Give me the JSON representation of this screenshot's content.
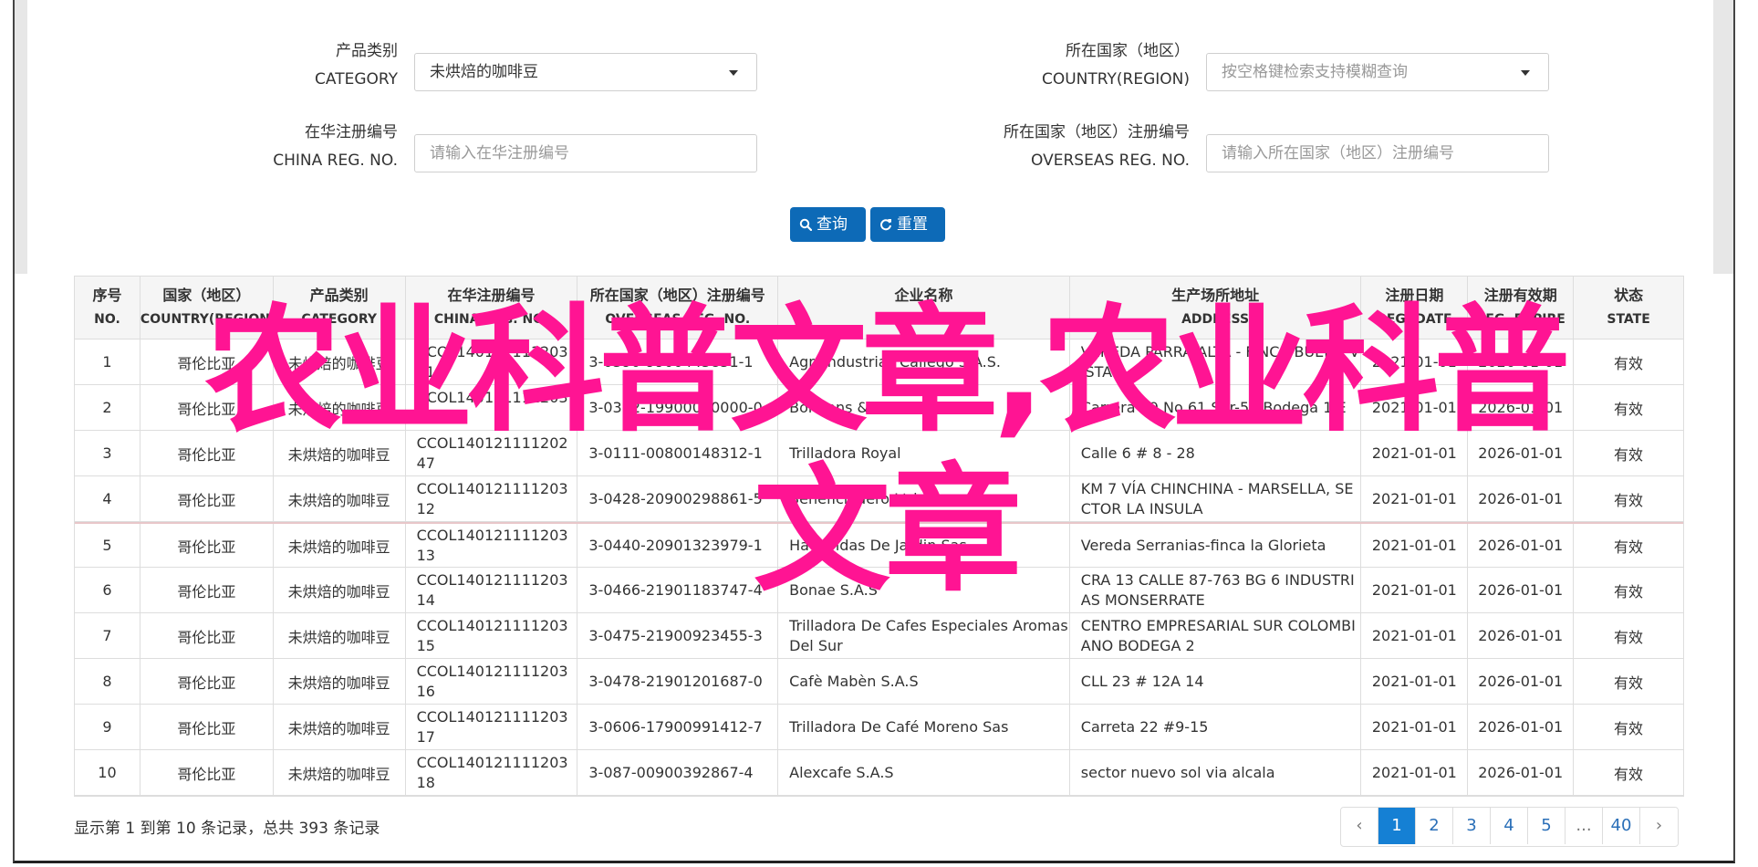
{
  "form": {
    "category_label_cn": "产品类别",
    "category_label_en": "CATEGORY",
    "category_value": "未烘焙的咖啡豆",
    "country_label_cn": "所在国家（地区）",
    "country_label_en": "COUNTRY(REGION)",
    "country_placeholder": "按空格键检索支持模糊查询",
    "china_reg_label_cn": "在华注册编号",
    "china_reg_label_en": "CHINA REG. NO.",
    "china_reg_placeholder": "请输入在华注册编号",
    "overseas_reg_label_cn": "所在国家（地区）注册编号",
    "overseas_reg_label_en": "OVERSEAS REG. NO.",
    "overseas_reg_placeholder": "请输入所在国家（地区）注册编号",
    "search_label": "查询",
    "reset_label": "重置",
    "button_color": "#0d6ab7"
  },
  "table": {
    "headers": [
      {
        "cn": "序号",
        "en": "NO."
      },
      {
        "cn": "国家（地区）",
        "en": "COUNTRY(REGION)"
      },
      {
        "cn": "产品类别",
        "en": "CATEGORY"
      },
      {
        "cn": "在华注册编号",
        "en": "CHINA REG. NO."
      },
      {
        "cn": "所在国家（地区）注册编号",
        "en": "OVERSEAS REG. NO."
      },
      {
        "cn": "企业名称",
        "en": "NAME"
      },
      {
        "cn": "生产场所地址",
        "en": "ADDRESS"
      },
      {
        "cn": "注册日期",
        "en": "REG. DATE"
      },
      {
        "cn": "注册有效期",
        "en": "REG. EXPIRE"
      },
      {
        "cn": "状态",
        "en": "STATE"
      }
    ],
    "rows": [
      {
        "no": "1",
        "country": "哥伦比亚",
        "category": "未烘焙的咖啡豆",
        "china_reg": "CCOL14012111120311",
        "overseas_reg": "3-0390-9900445851-1",
        "name": "Agroindustrias Callego S.A.S.",
        "address": "VEREDA PARRA ALTA - FINCA BUENA VISTA",
        "reg_date": "2021-01-01",
        "expire": "2026-01-01",
        "state": "有效"
      },
      {
        "no": "2",
        "country": "哥伦比亚",
        "category": "未烘焙的咖啡豆",
        "china_reg": "CCOL14012111120311",
        "overseas_reg": "3-0392-19900000000-0",
        "name": "Bonbons & Francis S.A.S.",
        "address": "Carrera 49 No 61 Sur-50 Bodega 1 E",
        "reg_date": "2021-01-01",
        "expire": "2026-01-01",
        "state": "有效"
      },
      {
        "no": "3",
        "country": "哥伦比亚",
        "category": "未烘焙的咖啡豆",
        "china_reg": "CCOL14012111120247",
        "overseas_reg": "3-0111-00800148312-1",
        "name": "Trilladora Royal",
        "address": "Calle 6 # 8 - 28",
        "reg_date": "2021-01-01",
        "expire": "2026-01-01",
        "state": "有效"
      },
      {
        "no": "4",
        "country": "哥伦比亚",
        "category": "未烘焙的咖啡豆",
        "china_reg": "CCOL14012111120312",
        "overseas_reg": "3-0428-20900298861-5",
        "name": "Beneficiadero Ltda",
        "address": "KM 7 VÍA CHINCHINA - MARSELLA, SECTOR LA INSULA",
        "reg_date": "2021-01-01",
        "expire": "2026-01-01",
        "state": "有效"
      },
      {
        "no": "5",
        "country": "哥伦比亚",
        "category": "未烘焙的咖啡豆",
        "china_reg": "CCOL14012111120313",
        "overseas_reg": "3-0440-20901323979-1",
        "name": "Haciendas De Jardin Sas",
        "address": "Vereda Serranias-finca la Glorieta",
        "reg_date": "2021-01-01",
        "expire": "2026-01-01",
        "state": "有效"
      },
      {
        "no": "6",
        "country": "哥伦比亚",
        "category": "未烘焙的咖啡豆",
        "china_reg": "CCOL14012111120314",
        "overseas_reg": "3-0466-21901183747-4",
        "name": "Bonae S.A.S",
        "address": "CRA 13 CALLE 87-763 BG 6 INDUSTRIAS MONSERRATE",
        "reg_date": "2021-01-01",
        "expire": "2026-01-01",
        "state": "有效"
      },
      {
        "no": "7",
        "country": "哥伦比亚",
        "category": "未烘焙的咖啡豆",
        "china_reg": "CCOL14012111120315",
        "overseas_reg": "3-0475-21900923455-3",
        "name": "Trilladora De Cafes Especiales Aromas Del Sur",
        "address": "CENTRO EMPRESARIAL SUR COLOMBIANO BODEGA 2",
        "reg_date": "2021-01-01",
        "expire": "2026-01-01",
        "state": "有效"
      },
      {
        "no": "8",
        "country": "哥伦比亚",
        "category": "未烘焙的咖啡豆",
        "china_reg": "CCOL14012111120316",
        "overseas_reg": "3-0478-21901201687-0",
        "name": "Cafè Mabèn S.A.S",
        "address": "CLL 23 # 12A 14",
        "reg_date": "2021-01-01",
        "expire": "2026-01-01",
        "state": "有效"
      },
      {
        "no": "9",
        "country": "哥伦比亚",
        "category": "未烘焙的咖啡豆",
        "china_reg": "CCOL14012111120317",
        "overseas_reg": "3-0606-17900991412-7",
        "name": "Trilladora De Café Moreno Sas",
        "address": "Carreta 22 #9-15",
        "reg_date": "2021-01-01",
        "expire": "2026-01-01",
        "state": "有效"
      },
      {
        "no": "10",
        "country": "哥伦比亚",
        "category": "未烘焙的咖啡豆",
        "china_reg": "CCOL14012111120318",
        "overseas_reg": "3-087-00900392867-4",
        "name": "Alexcafe S.A.S",
        "address": "sector nuevo sol via alcala",
        "reg_date": "2021-01-01",
        "expire": "2026-01-01",
        "state": "有效"
      }
    ]
  },
  "summary": "显示第 1 到第 10 条记录，总共 393 条记录",
  "pagination": {
    "prev": "‹",
    "pages": [
      "1",
      "2",
      "3",
      "4",
      "5",
      "...",
      "40"
    ],
    "next": "›",
    "active": "1",
    "active_color": "#1580d4"
  },
  "watermark": {
    "line1": "农业科普文章,农业科普",
    "line2": "文章",
    "color": "#ff1493"
  }
}
